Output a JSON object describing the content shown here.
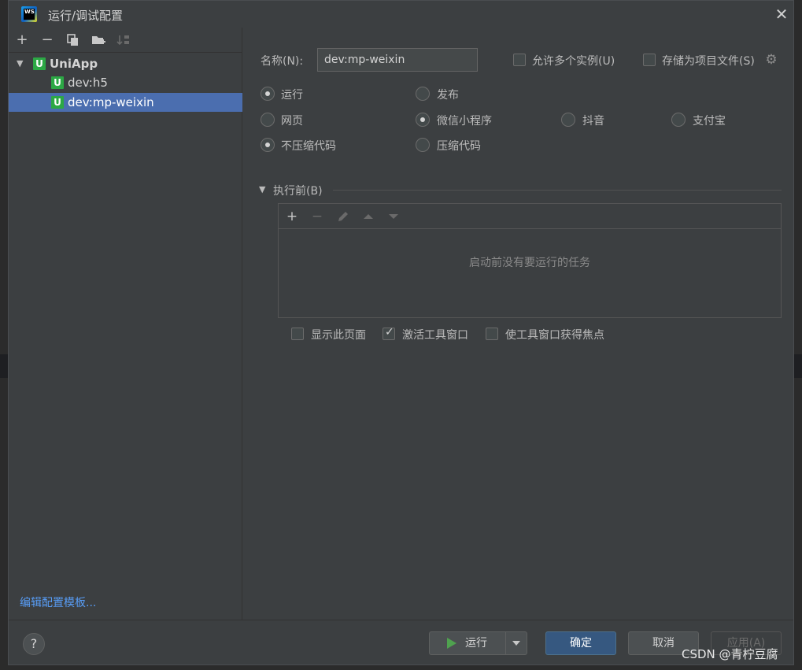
{
  "window": {
    "title": "运行/调试配置"
  },
  "left_toolbar": {
    "add": "+",
    "remove": "−"
  },
  "tree": {
    "root": "UniApp",
    "items": [
      "dev:h5",
      "dev:mp-weixin"
    ],
    "icon_letter": "U"
  },
  "edit_templates": "编辑配置模板...",
  "form": {
    "name_label": "名称(N):",
    "name_value": "dev:mp-weixin",
    "allow_parallel": "允许多个实例(U)",
    "store_as_file": "存储为项目文件(S)"
  },
  "radios": {
    "run": "运行",
    "publish": "发布",
    "web": "网页",
    "wechat": "微信小程序",
    "douyin": "抖音",
    "alipay": "支付宝",
    "no_compress": "不压缩代码",
    "compress": "压缩代码"
  },
  "before_launch": {
    "title": "执行前(B)",
    "add": "+",
    "remove": "−",
    "empty": "启动前没有要运行的任务"
  },
  "options": {
    "show_page": "显示此页面",
    "activate_tool_window": "激活工具窗口",
    "focus_tool_window": "使工具窗口获得焦点"
  },
  "footer": {
    "help": "?",
    "run": "运行",
    "ok": "确定",
    "cancel": "取消",
    "apply": "应用(A)"
  },
  "watermark": "CSDN @青柠豆腐",
  "colors": {
    "accent": "#4b6eaf",
    "primary_button": "#365880",
    "uniapp_icon": "#2ca845",
    "link": "#589df6"
  }
}
